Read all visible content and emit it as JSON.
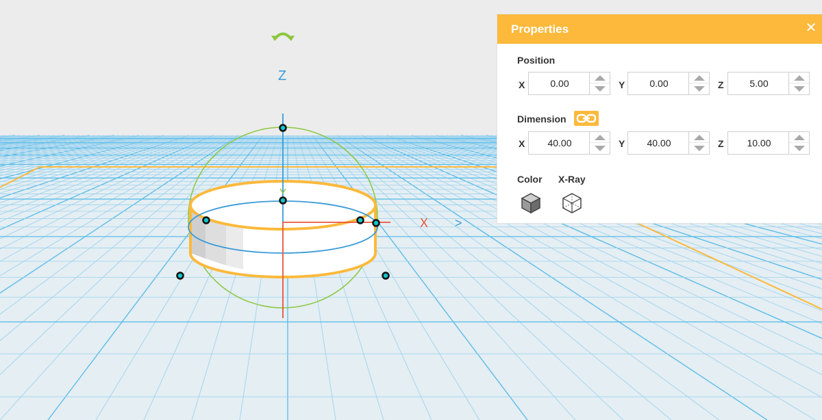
{
  "viewport": {
    "gizmo": {
      "z_label": "Z",
      "x_label": "X",
      "y_label": ">",
      "rotate_icon": "rotate-arrow-icon"
    },
    "colors": {
      "background": "#ececec",
      "grid": "#5dbde8",
      "grid_minor": "#b9dff0",
      "object_outline": "#fcb93b",
      "z_axis": "#3a9bd8",
      "x_axis": "#e8553a",
      "y_axis": "#8cc63f"
    }
  },
  "properties": {
    "title": "Properties",
    "close_icon": "close-icon",
    "position": {
      "label": "Position",
      "x_label": "X",
      "x_value": "0.00",
      "y_label": "Y",
      "y_value": "0.00",
      "z_label": "Z",
      "z_value": "5.00"
    },
    "dimension": {
      "label": "Dimension",
      "link_icon": "link-proportions-icon",
      "x_label": "X",
      "x_value": "40.00",
      "y_label": "Y",
      "y_value": "40.00",
      "z_label": "Z",
      "z_value": "10.00"
    },
    "color_label": "Color",
    "xray_label": "X-Ray",
    "accent": "#fcb93b"
  }
}
